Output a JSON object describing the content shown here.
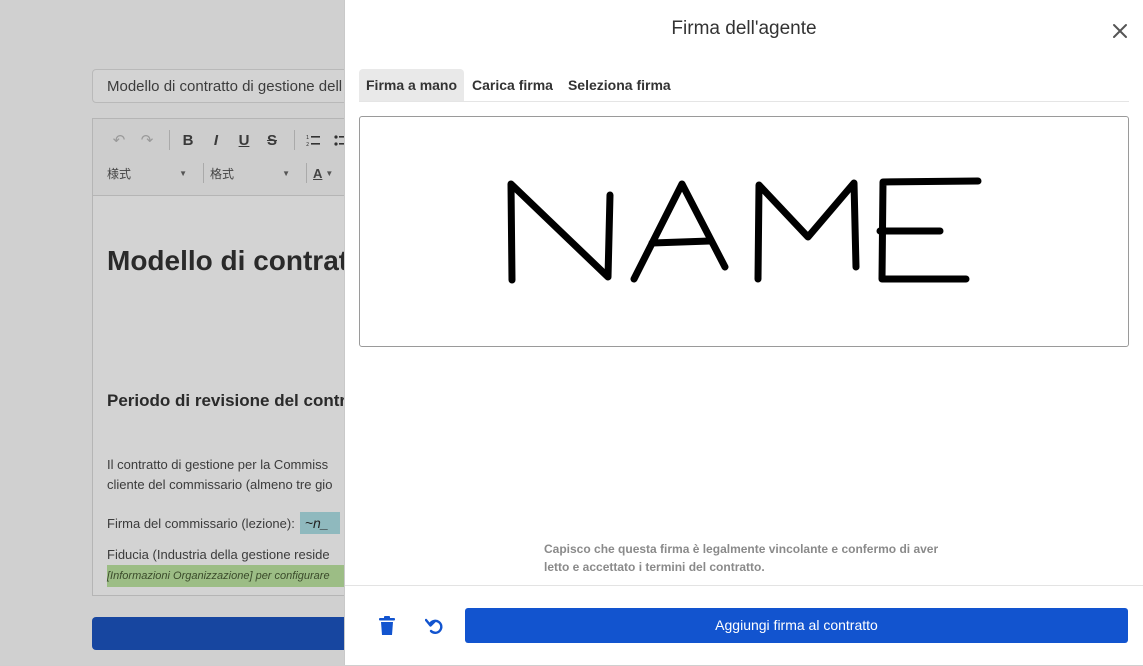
{
  "background": {
    "title_value": "Modello di contratto di gestione dell",
    "toolbar": {
      "undo_icon": "undo-icon",
      "redo_icon": "redo-icon",
      "bold_label": "B",
      "italic_label": "I",
      "underline_label": "U",
      "strike_label": "S",
      "style_select": "様式",
      "format_select": "格式",
      "text_color_label": "A"
    },
    "heading": "Modello di contratt",
    "subheading": "Periodo di revisione del contr",
    "paragraph_line1": "Il contratto di gestione per la Commiss",
    "paragraph_line2": "cliente del commissario (almeno tre gio",
    "signature_label": "Firma del commissario (lezione):",
    "signature_chip": "~n_",
    "trust_line": "Fiducia (Industria della gestione reside",
    "highlight_line": "[Informazioni Organizzazione] per configurare",
    "cutoff_text": "· • · • · · · · · · · · · · · · ·"
  },
  "modal": {
    "title": "Firma dell'agente",
    "close_icon": "close-icon",
    "tabs": [
      "Firma a mano",
      "Carica firma",
      "Seleziona firma"
    ],
    "active_tab": "Firma a mano",
    "drawn_signature": "NAME",
    "legal_text": "Capisco che questa firma è legalmente vincolante e confermo di aver letto e accettato i termini del contratto.",
    "footer": {
      "delete_icon": "trash-icon",
      "reset_icon": "undo-icon",
      "submit_label": "Aggiungi firma al contratto"
    }
  },
  "colors": {
    "primary": "#1254cf",
    "overlay_bg": "#d0d0d0",
    "highlight_green": "#9cbd85",
    "chip_teal": "#8fb9be"
  }
}
